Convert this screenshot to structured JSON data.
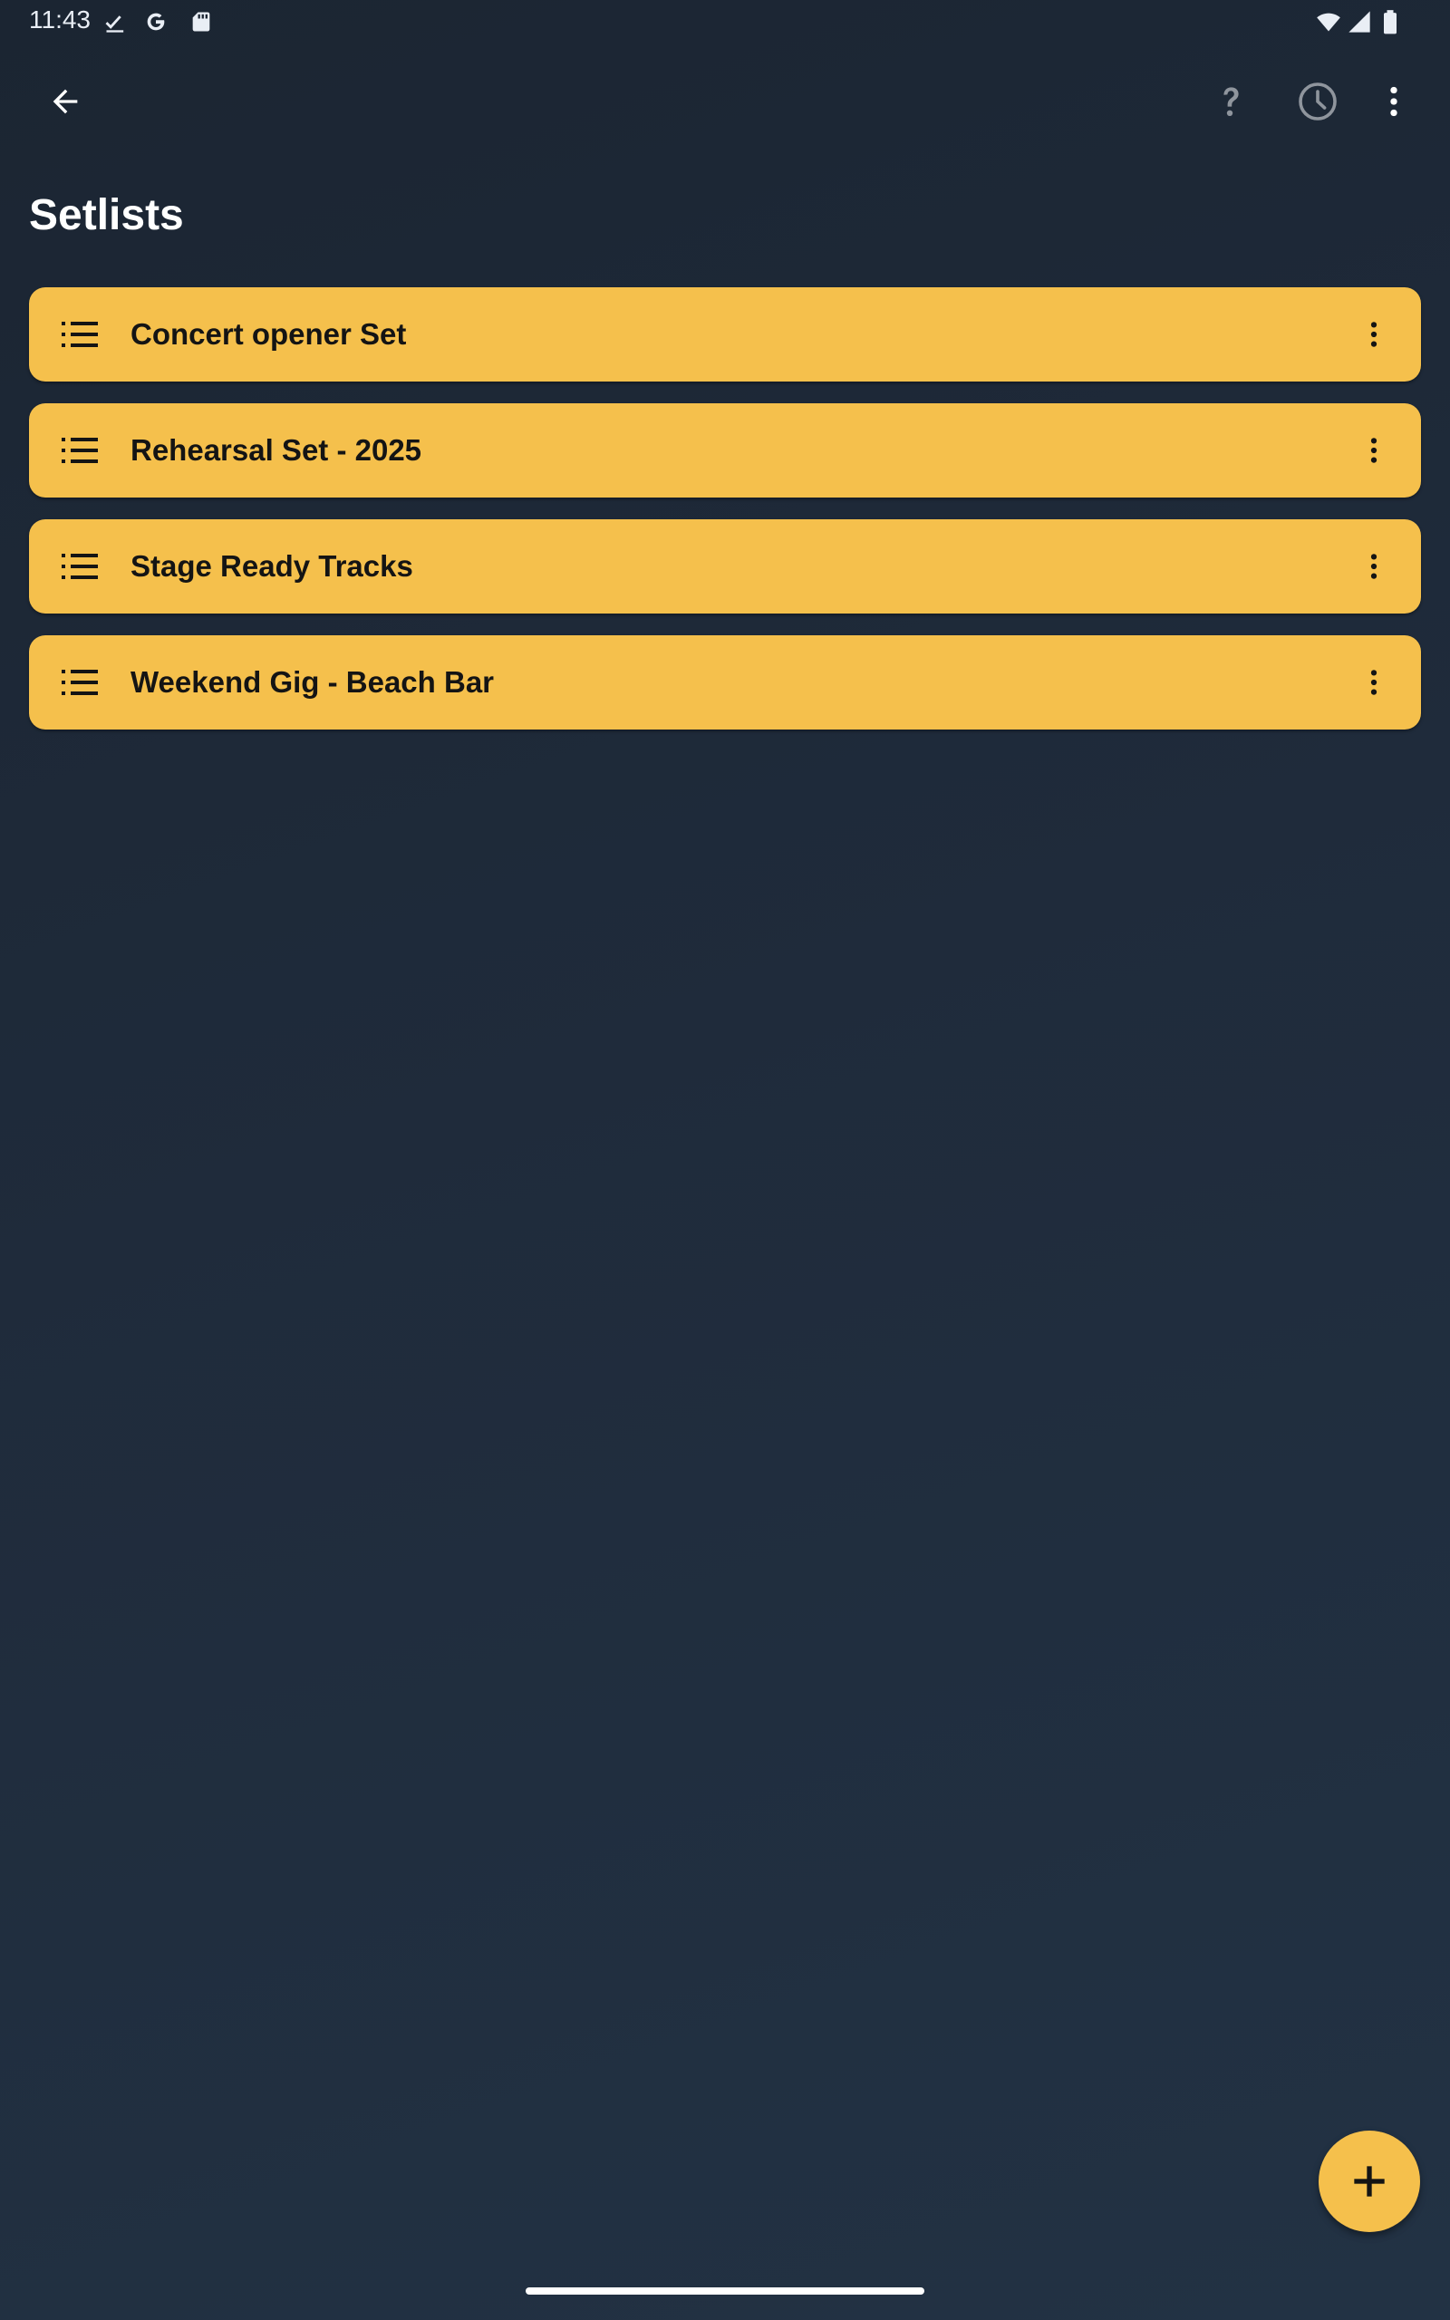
{
  "status_bar": {
    "time": "11:43",
    "left_icons": [
      "check-download-icon",
      "google-icon",
      "sd-card-icon"
    ],
    "right_icons": [
      "wifi-icon",
      "signal-icon",
      "battery-icon"
    ]
  },
  "app_bar": {
    "back_icon": "arrow-back-icon",
    "help_icon": "help-icon",
    "history_icon": "history-clock-icon",
    "overflow_icon": "more-vert-icon"
  },
  "page": {
    "title": "Setlists"
  },
  "setlists": [
    {
      "label": "Concert opener Set"
    },
    {
      "label": "Rehearsal Set - 2025"
    },
    {
      "label": "Stage Ready Tracks"
    },
    {
      "label": "Weekend Gig - Beach Bar"
    }
  ],
  "fab": {
    "icon": "add-icon"
  },
  "colors": {
    "accent": "#f5c04c",
    "background": "#1f2b3b",
    "item_text": "#141414"
  }
}
